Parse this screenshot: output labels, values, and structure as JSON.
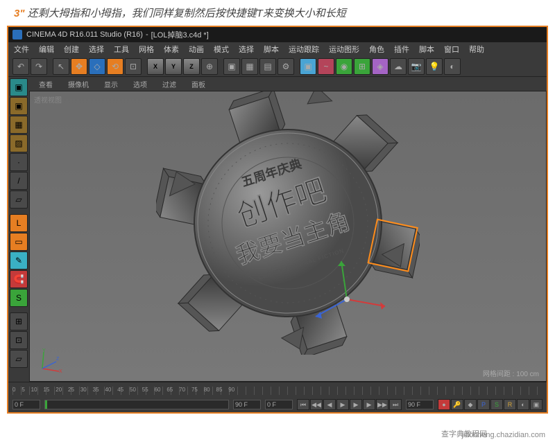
{
  "tutorial": {
    "step": "3\"",
    "text": "还剩大拇指和小拇指，我们同样复制然后按快捷键T来变换大小和长短"
  },
  "titlebar": {
    "app": "CINEMA 4D R16.011 Studio (R16)",
    "file": "[LOL掉脑3.c4d *]"
  },
  "menu": [
    "文件",
    "编辑",
    "创建",
    "选择",
    "工具",
    "网格",
    "体素",
    "动画",
    "模式",
    "选择",
    "脚本",
    "运动跟踪",
    "运动图形",
    "角色",
    "插件",
    "脚本",
    "窗口",
    "帮助"
  ],
  "vp_header": {
    "tabs": [
      "查看",
      "摄像机",
      "显示",
      "选项",
      "过滤",
      "面板"
    ]
  },
  "viewport": {
    "label": "透视视图",
    "footer_label": "网格间距",
    "footer_value": "100 cm"
  },
  "badge_text": {
    "top_arc": "五周年庆典",
    "line1": "创作吧",
    "line2": "我要当主角",
    "sub": "CREATE ORIGINAL FICTION"
  },
  "timeline": {
    "start": "0 F",
    "end": "90 F",
    "current": "0 F",
    "end2": "90 F"
  },
  "footer": {
    "site": "查字典教程网",
    "url": "jiaocheng.chazidian.com"
  }
}
